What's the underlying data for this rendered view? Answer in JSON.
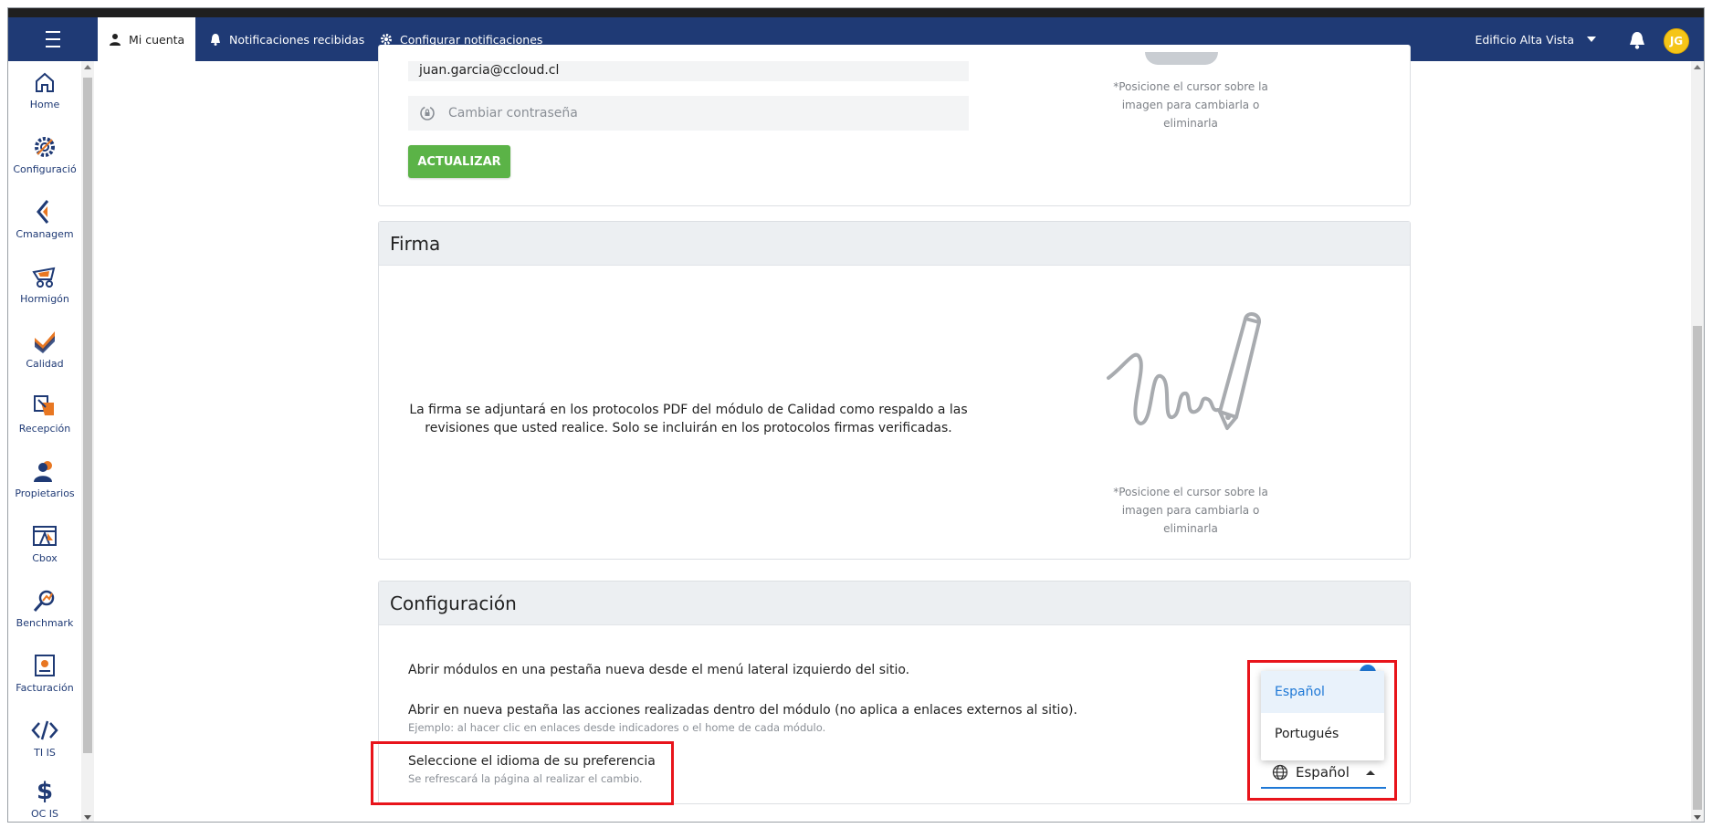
{
  "topbar": {
    "menu_icon": "hamburger-icon",
    "tabs": [
      {
        "label": "Mi cuenta",
        "icon": "user-icon"
      },
      {
        "label": "Notificaciones recibidas",
        "icon": "bell-icon"
      },
      {
        "label": "Configurar notificaciones",
        "icon": "gear-icon"
      }
    ],
    "project": "Edificio Alta Vista",
    "avatar_initials": "JG",
    "colors": {
      "bar": "#1f3a75",
      "avatar": "#f5c518"
    }
  },
  "sidebar": {
    "items": [
      {
        "label": "Home",
        "icon": "home-icon"
      },
      {
        "label": "Configuració",
        "icon": "settings-icon"
      },
      {
        "label": "Cmanagem",
        "icon": "cmanagement-icon"
      },
      {
        "label": "Hormigón",
        "icon": "concrete-mixer-icon"
      },
      {
        "label": "Calidad",
        "icon": "quality-check-icon"
      },
      {
        "label": "Recepción",
        "icon": "reception-icon"
      },
      {
        "label": "Propietarios",
        "icon": "owners-icon"
      },
      {
        "label": "Cbox",
        "icon": "cbox-icon"
      },
      {
        "label": "Benchmark",
        "icon": "benchmark-icon"
      },
      {
        "label": "Facturación",
        "icon": "billing-icon"
      },
      {
        "label": "TI IS",
        "icon": "code-icon"
      },
      {
        "label": "OC IS",
        "icon": "dollar-icon"
      }
    ]
  },
  "account": {
    "email": "juan.garcia@ccloud.cl",
    "change_password_placeholder": "Cambiar contraseña",
    "update_button": "ACTUALIZAR",
    "photo_hint": [
      "*Posicione el cursor sobre la",
      "imagen para cambiarla o",
      "eliminarla"
    ]
  },
  "firma": {
    "title": "Firma",
    "description": "La firma se adjuntará en los protocolos PDF del módulo de Calidad como respaldo a las revisiones que usted realice. Solo se incluirán en los protocolos firmas verificadas.",
    "hint": [
      "*Posicione el cursor sobre la",
      "imagen para cambiarla o",
      "eliminarla"
    ]
  },
  "configuracion": {
    "title": "Configuración",
    "rows": [
      {
        "label": "Abrir módulos en una pestaña nueva desde el menú lateral izquierdo del sitio.",
        "sub": ""
      },
      {
        "label": "Abrir en nueva pestaña las acciones realizadas dentro del módulo (no aplica a enlaces externos al sitio).",
        "sub": "Ejemplo: al hacer clic en enlaces desde indicadores o el home de cada módulo."
      },
      {
        "label": "Seleccione el idioma de su preferencia",
        "sub": "Se refrescará la página al realizar el cambio."
      }
    ],
    "language": {
      "selected": "Español",
      "options": [
        "Español",
        "Portugués"
      ],
      "icon": "globe-icon"
    }
  }
}
